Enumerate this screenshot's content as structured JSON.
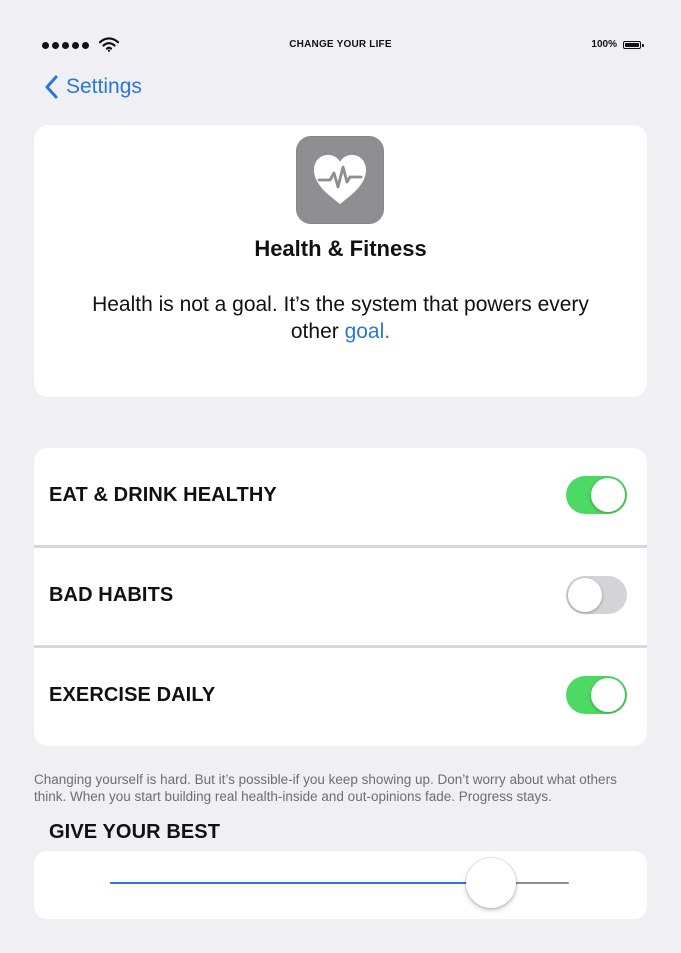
{
  "status_bar": {
    "carrier": "CHANGE YOUR LIFE",
    "battery": "100%",
    "signal_bars": 5
  },
  "nav": {
    "back_label": "Settings"
  },
  "hero": {
    "icon": "heart-pulse-icon",
    "title": "Health & Fitness",
    "text_before_link": "Health is not a goal. It’s the system that powers every other ",
    "link_text": "goal."
  },
  "settings": [
    {
      "label": "EAT & DRINK HEALTHY",
      "enabled": true
    },
    {
      "label": "BAD HABITS",
      "enabled": false
    },
    {
      "label": "EXERCISE DAILY",
      "enabled": true
    }
  ],
  "footer_note": "Changing yourself is hard. But it’s possible-if you keep showing up. Don’t worry about what others think. When you start building real health-inside and out-opinions fade. Progress stays.",
  "slider": {
    "heading": "GIVE YOUR BEST",
    "value": 0.83
  },
  "colors": {
    "accent": "#2a78d3",
    "toggle_on": "#4cd964",
    "toggle_off": "#d4d4d8",
    "background": "#efeff4",
    "icon_bg": "#8e8e93"
  }
}
